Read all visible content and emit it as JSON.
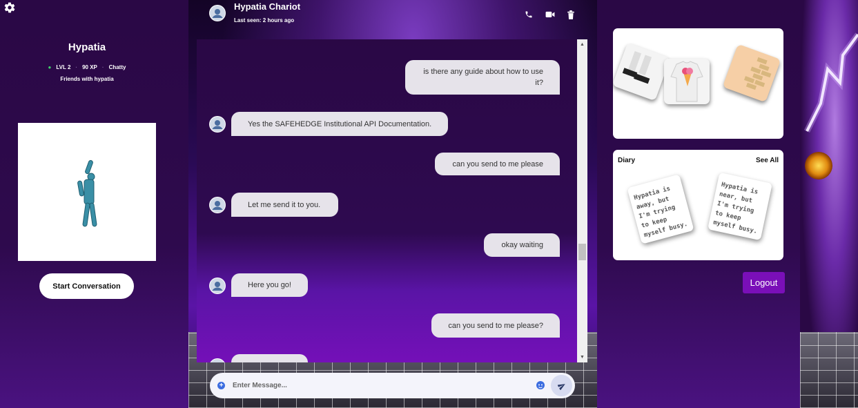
{
  "profile": {
    "name": "Hypatia",
    "level": "LVL 2",
    "xp": "90 XP",
    "trait": "Chatty",
    "friendship": "Friends with hypatia",
    "start_button": "Start Conversation"
  },
  "chat": {
    "contact_name": "Hypatia Chariot",
    "last_seen": "Last seen: 2 hours ago",
    "header_icons": [
      "phone-icon",
      "video-icon",
      "trash-icon"
    ],
    "messages": [
      {
        "direction": "out",
        "text": "is there any guide about how to use it?"
      },
      {
        "direction": "in",
        "text": "Yes the SAFEHEDGE Institutional API Documentation."
      },
      {
        "direction": "out",
        "text": "can you send to me please"
      },
      {
        "direction": "in",
        "text": "Let me send it to you."
      },
      {
        "direction": "out",
        "text": "okay waiting"
      },
      {
        "direction": "in",
        "text": "Here you go!"
      },
      {
        "direction": "out",
        "text": "can you send to me please?"
      }
    ],
    "input_placeholder": "Enter Message..."
  },
  "diary": {
    "title": "Diary",
    "see_all": "See All",
    "notes": [
      "Hypatia is away, but I'm trying to keep myself busy.",
      "Hypatia is near, but I'm trying to keep myself busy."
    ]
  },
  "logout_label": "Logout",
  "colors": {
    "accent": "#7a0fb8",
    "bubble": "#e6e3ea",
    "background": "#2a0845"
  }
}
